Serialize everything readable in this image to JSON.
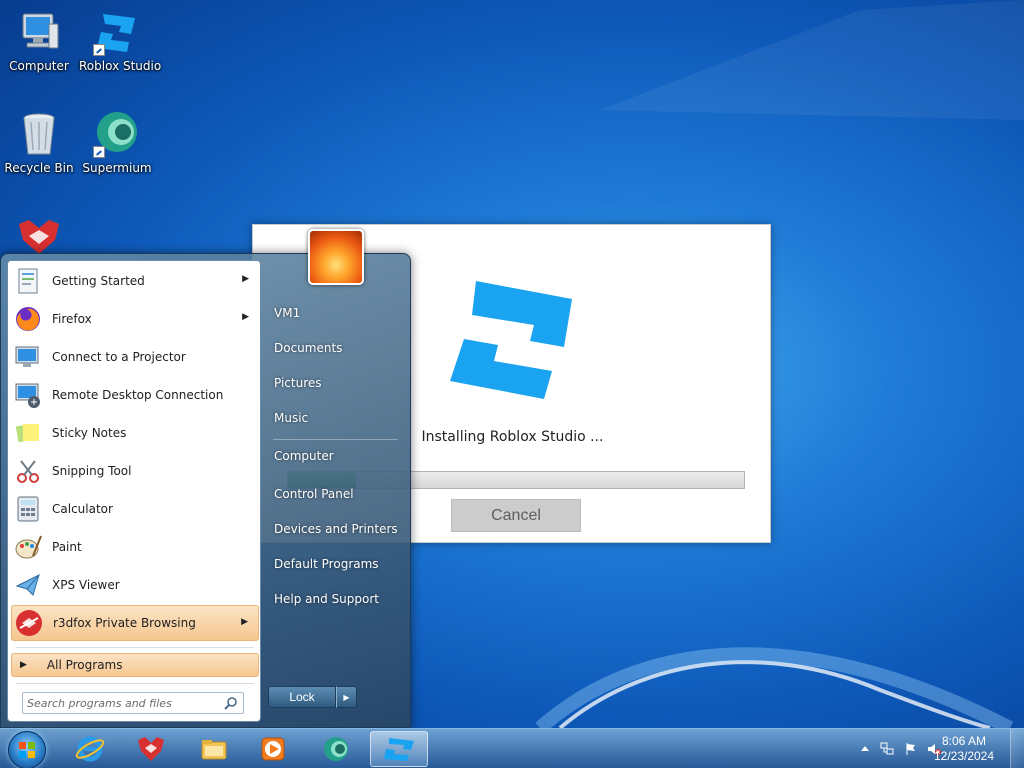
{
  "desktop": {
    "icons": [
      {
        "label": "Computer",
        "icon": "computer-icon"
      },
      {
        "label": "Roblox Studio",
        "icon": "roblox-studio-icon"
      },
      {
        "label": "Recycle Bin",
        "icon": "recycle-bin-icon"
      },
      {
        "label": "Supermium",
        "icon": "supermium-icon"
      },
      {
        "label": "",
        "icon": "r3dfox-icon"
      }
    ]
  },
  "installer": {
    "status_text": "Installing Roblox Studio ...",
    "progress_fraction": 0.15,
    "cancel_label": "Cancel",
    "accent_color": "#1aa3f0"
  },
  "start_menu": {
    "programs": [
      {
        "label": "Getting Started",
        "icon": "getting-started-icon",
        "has_submenu": true
      },
      {
        "label": "Firefox",
        "icon": "firefox-icon",
        "has_submenu": true
      },
      {
        "label": "Connect to a Projector",
        "icon": "projector-icon",
        "has_submenu": false
      },
      {
        "label": "Remote Desktop Connection",
        "icon": "remote-desktop-icon",
        "has_submenu": false
      },
      {
        "label": "Sticky Notes",
        "icon": "sticky-notes-icon",
        "has_submenu": false
      },
      {
        "label": "Snipping Tool",
        "icon": "snipping-tool-icon",
        "has_submenu": false
      },
      {
        "label": "Calculator",
        "icon": "calculator-icon",
        "has_submenu": false
      },
      {
        "label": "Paint",
        "icon": "paint-icon",
        "has_submenu": false
      },
      {
        "label": "XPS Viewer",
        "icon": "xps-viewer-icon",
        "has_submenu": false
      },
      {
        "label": "r3dfox Private Browsing",
        "icon": "r3dfox-private-icon",
        "has_submenu": true,
        "highlighted": true
      }
    ],
    "all_programs_label": "All Programs",
    "search_placeholder": "Search programs and files",
    "places": [
      "VM1",
      "Documents",
      "Pictures",
      "Music",
      "Computer",
      "Control Panel",
      "Devices and Printers",
      "Default Programs",
      "Help and Support"
    ],
    "lock_label": "Lock"
  },
  "taskbar": {
    "pinned": [
      {
        "icon": "internet-explorer-icon"
      },
      {
        "icon": "r3dfox-icon"
      },
      {
        "icon": "file-explorer-icon"
      },
      {
        "icon": "media-player-icon"
      },
      {
        "icon": "supermium-icon"
      },
      {
        "icon": "roblox-studio-icon",
        "active": true
      }
    ],
    "clock": {
      "time": "8:06 AM",
      "date": "12/23/2024"
    }
  }
}
